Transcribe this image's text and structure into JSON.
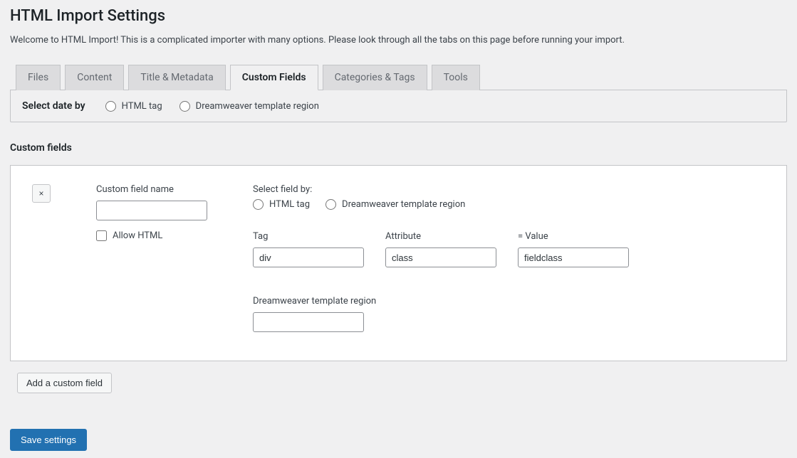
{
  "page_title": "HTML Import Settings",
  "intro": "Welcome to HTML Import! This is a complicated importer with many options. Please look through all the tabs on this page before running your import.",
  "tabs": {
    "files": "Files",
    "content": "Content",
    "title_metadata": "Title & Metadata",
    "custom_fields": "Custom Fields",
    "categories_tags": "Categories & Tags",
    "tools": "Tools"
  },
  "date_panel": {
    "label": "Select date by",
    "option_html": "HTML tag",
    "option_dw": "Dreamweaver template region"
  },
  "section_title": "Custom fields",
  "cf": {
    "remove_label": "×",
    "name_label": "Custom field name",
    "name_value": "",
    "allow_html_label": "Allow HTML",
    "select_field_by": "Select field by:",
    "option_html": "HTML tag",
    "option_dw": "Dreamweaver template region",
    "tag_label": "Tag",
    "tag_value": "div",
    "attr_label": "Attribute",
    "attr_value": "class",
    "value_label": "= Value",
    "value_value": "fieldclass",
    "dw_region_label": "Dreamweaver template region",
    "dw_region_value": ""
  },
  "add_button": "Add a custom field",
  "save_button": "Save settings"
}
